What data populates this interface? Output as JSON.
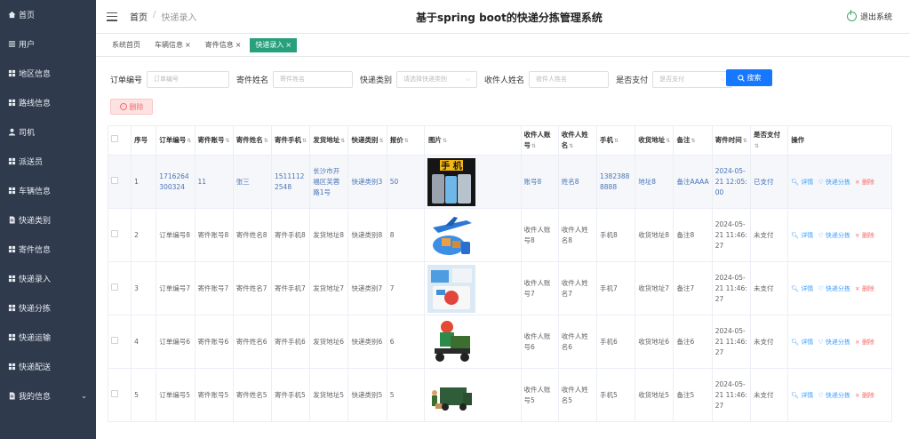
{
  "app": {
    "title": "基于spring boot的快递分拣管理系统",
    "logout_label": "退出系统"
  },
  "breadcrumb": {
    "home": "首页",
    "sep": "/",
    "current": "快递录入"
  },
  "sidebar": {
    "items": [
      {
        "label": "首页",
        "icon": "home-icon"
      },
      {
        "label": "用户",
        "icon": "list-icon"
      },
      {
        "label": "地区信息",
        "icon": "grid-icon"
      },
      {
        "label": "路线信息",
        "icon": "grid-icon"
      },
      {
        "label": "司机",
        "icon": "user-icon"
      },
      {
        "label": "派送员",
        "icon": "grid-icon"
      },
      {
        "label": "车辆信息",
        "icon": "grid-icon"
      },
      {
        "label": "快递类别",
        "icon": "document-icon"
      },
      {
        "label": "寄件信息",
        "icon": "grid-icon"
      },
      {
        "label": "快递录入",
        "icon": "grid-icon"
      },
      {
        "label": "快递分拣",
        "icon": "grid-icon"
      },
      {
        "label": "快递运输",
        "icon": "grid-icon"
      },
      {
        "label": "快递配送",
        "icon": "grid-icon"
      },
      {
        "label": "我的信息",
        "icon": "document-icon"
      }
    ]
  },
  "tags": [
    {
      "label": "系统首页",
      "closable": false,
      "active": false
    },
    {
      "label": "车辆信息",
      "closable": true,
      "active": false
    },
    {
      "label": "寄件信息",
      "closable": true,
      "active": false
    },
    {
      "label": "快递录入",
      "closable": true,
      "active": true
    }
  ],
  "search": {
    "order_label": "订单编号",
    "order_placeholder": "订单编号",
    "sender_label": "寄件姓名",
    "sender_placeholder": "寄件姓名",
    "type_label": "快递类别",
    "type_placeholder": "请选择快递类别",
    "receiver_label": "收件人姓名",
    "receiver_placeholder": "收件人姓名",
    "paid_label": "是否支付",
    "paid_placeholder": "是否支付",
    "button_label": "搜索"
  },
  "actions": {
    "delete_label": "删除"
  },
  "table": {
    "columns": [
      "序号",
      "订单编号",
      "寄件账号",
      "寄件姓名",
      "寄件手机",
      "发货地址",
      "快递类别",
      "报价",
      "图片",
      "收件人账号",
      "收件人姓名",
      "手机",
      "收货地址",
      "备注",
      "寄件时间",
      "是否支付",
      "操作"
    ],
    "op_labels": {
      "detail": "详情",
      "sort": "快递分拣",
      "delete": "删除"
    },
    "rows": [
      {
        "no": "1",
        "order": "1716264300324",
        "acct": "11",
        "name": "张三",
        "phone": "15111122548",
        "addr": "长沙市开福区芙蓉路1号",
        "type": "快递类别3",
        "price": "50",
        "img": "phone",
        "racct": "账号8",
        "rname": "姓名8",
        "rphone": "13823888888",
        "raddr": "地址8",
        "note": "备注AAAA",
        "time": "2024-05-21 12:05:00",
        "paid": "已支付"
      },
      {
        "no": "2",
        "order": "订单编号8",
        "acct": "寄件账号8",
        "name": "寄件姓名8",
        "phone": "寄件手机8",
        "addr": "发货地址8",
        "type": "快递类别8",
        "price": "8",
        "img": "plane",
        "racct": "收件人账号8",
        "rname": "收件人姓名8",
        "rphone": "手机8",
        "raddr": "收货地址8",
        "note": "备注8",
        "time": "2024-05-21 11:46:27",
        "paid": "未支付"
      },
      {
        "no": "3",
        "order": "订单编号7",
        "acct": "寄件账号7",
        "name": "寄件姓名7",
        "phone": "寄件手机7",
        "addr": "发货地址7",
        "type": "快递类别7",
        "price": "7",
        "img": "boxes",
        "racct": "收件人账号7",
        "rname": "收件人姓名7",
        "rphone": "手机7",
        "raddr": "收货地址7",
        "note": "备注7",
        "time": "2024-05-21 11:46:27",
        "paid": "未支付"
      },
      {
        "no": "4",
        "order": "订单编号6",
        "acct": "寄件账号6",
        "name": "寄件姓名6",
        "phone": "寄件手机6",
        "addr": "发货地址6",
        "type": "快递类别6",
        "price": "6",
        "img": "scooter",
        "racct": "收件人账号6",
        "rname": "收件人姓名6",
        "rphone": "手机6",
        "raddr": "收货地址6",
        "note": "备注6",
        "time": "2024-05-21 11:46:27",
        "paid": "未支付"
      },
      {
        "no": "5",
        "order": "订单编号5",
        "acct": "寄件账号5",
        "name": "寄件姓名5",
        "phone": "寄件手机5",
        "addr": "发货地址5",
        "type": "快递类别5",
        "price": "5",
        "img": "truck",
        "racct": "收件人账号5",
        "rname": "收件人姓名5",
        "rphone": "手机5",
        "raddr": "收货地址5",
        "note": "备注5",
        "time": "2024-05-21 11:46:27",
        "paid": "未支付"
      }
    ]
  },
  "colors": {
    "sidebar": "#2f3a4c",
    "accent": "#29a07c",
    "primary": "#1677ff",
    "danger": "#f56c6c"
  }
}
